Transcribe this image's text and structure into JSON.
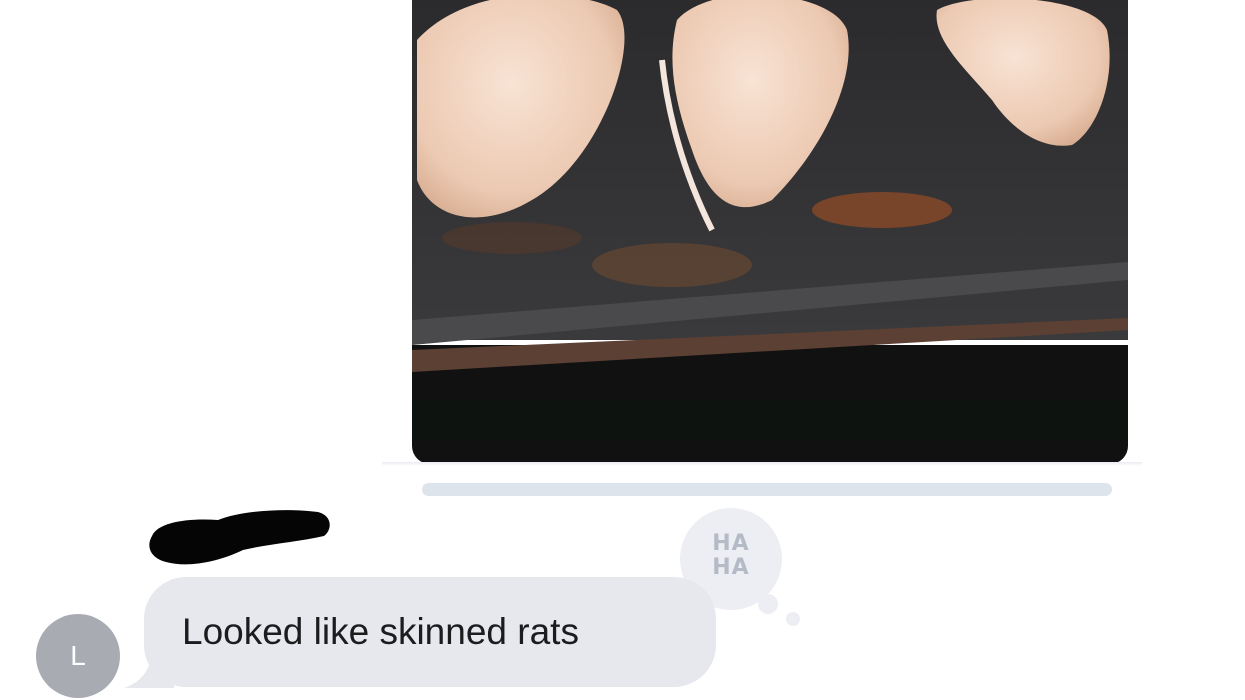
{
  "attachment": {
    "kind": "photo",
    "description_icon": "photo-of-raw-chicken-on-baking-sheet"
  },
  "sender": {
    "name": "[redacted]",
    "avatar_initial": "L"
  },
  "message": {
    "text": "Looked like skinned rats"
  },
  "reaction": {
    "label": "HA HA",
    "icon": "haha-reaction-icon"
  },
  "colors": {
    "incoming_bubble": "#e6e8ee",
    "avatar": "#a9abb3",
    "reaction_bg": "#eceef3",
    "reaction_text": "#b4bac6"
  }
}
